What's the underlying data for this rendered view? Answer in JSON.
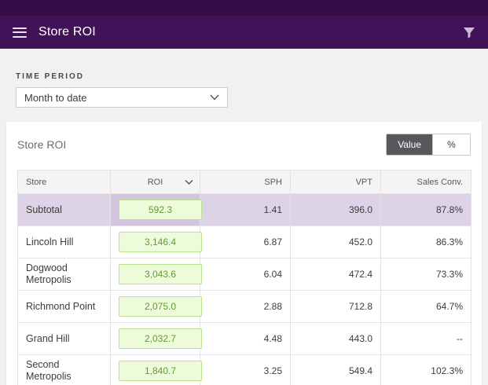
{
  "header": {
    "title": "Store ROI"
  },
  "filters": {
    "time_period_label": "TIME PERIOD",
    "time_period_value": "Month to date"
  },
  "card": {
    "title": "Store ROI",
    "toggle": {
      "options": [
        "Value",
        "%"
      ],
      "selected": "Value"
    }
  },
  "table": {
    "columns": [
      "Store",
      "ROI",
      "SPH",
      "VPT",
      "Sales Conv."
    ],
    "sorted_column": "ROI",
    "sort_direction": "desc",
    "rows": [
      {
        "store": "Subtotal",
        "roi": "592.3",
        "sph": "1.41",
        "vpt": "396.0",
        "sales_conv": "87.8%",
        "subtotal": true
      },
      {
        "store": "Lincoln Hill",
        "roi": "3,146.4",
        "sph": "6.87",
        "vpt": "452.0",
        "sales_conv": "86.3%"
      },
      {
        "store": "Dogwood Metropolis",
        "roi": "3,043.6",
        "sph": "6.04",
        "vpt": "472.4",
        "sales_conv": "73.3%"
      },
      {
        "store": "Richmond Point",
        "roi": "2,075.0",
        "sph": "2.88",
        "vpt": "712.8",
        "sales_conv": "64.7%"
      },
      {
        "store": "Grand Hill",
        "roi": "2,032.7",
        "sph": "4.48",
        "vpt": "443.0",
        "sales_conv": "--"
      },
      {
        "store": "Second Metropolis",
        "roi": "1,840.7",
        "sph": "3.25",
        "vpt": "549.4",
        "sales_conv": "102.3%"
      }
    ]
  },
  "colors": {
    "topstrip-bg": "#350d47",
    "header-bg": "#421259",
    "page-bg": "#f1f1f1",
    "accent-green-bg": "#edfbdb",
    "accent-green-border": "#b9e18f",
    "accent-green-text": "#5f9c34",
    "subtotal-bg": "#ddd3e6",
    "subtotal-roi-bg": "#d3c5de",
    "toggle-active-bg": "#57585c"
  }
}
